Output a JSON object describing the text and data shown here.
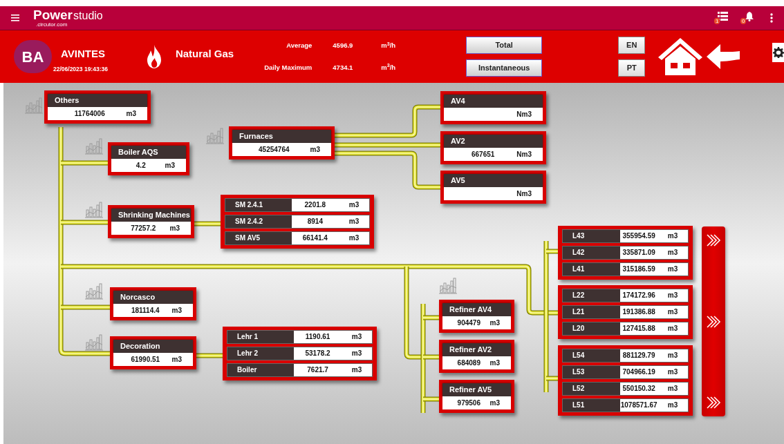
{
  "top_bar": {
    "logo": {
      "brand": "Power",
      "product": "studio",
      "domain": ".circutor.com"
    },
    "notifications": [
      {
        "kind": "list",
        "count": "1"
      },
      {
        "kind": "bell",
        "count": "0"
      }
    ]
  },
  "header": {
    "avatar": "BA",
    "site": "AVINTES",
    "datetime": "22/06/2023 19:43:36",
    "energy": "Natural Gas",
    "stats": [
      {
        "label": "Average",
        "value": "4596.9",
        "unit": "m$^{3}$/h"
      },
      {
        "label": "Daily Maximum",
        "value": "4734.1",
        "unit": "m$^{3}$/h"
      }
    ],
    "mode_buttons": [
      "Total",
      "Instantaneous"
    ],
    "language_buttons": [
      "EN",
      "PT"
    ]
  },
  "nodes": [
    {
      "title": "Others",
      "value": "11764006",
      "unit": "m3",
      "chart_icon": true
    },
    {
      "title": "Boiler AQS",
      "value": "4.2",
      "unit": "m3",
      "chart_icon": true
    },
    {
      "title": "Furnaces",
      "value": "45254764",
      "unit": "m3",
      "chart_icon": true
    },
    {
      "title": "Shrinking Machines",
      "value": "77257.2",
      "unit": "m3",
      "chart_icon": true
    },
    {
      "title": "AV4",
      "unit": "Nm3",
      "chart_icon": false
    },
    {
      "title": "AV2",
      "value": "667651",
      "unit": "Nm3",
      "chart_icon": false
    },
    {
      "title": "AV5",
      "unit": "Nm3",
      "chart_icon": false
    },
    {
      "title": "Norcasco",
      "value": "181114.4",
      "unit": "m3",
      "chart_icon": true
    },
    {
      "title": "Decoration",
      "value": "61990.51",
      "unit": "m3",
      "chart_icon": true
    },
    {
      "title": "Refiner AV4",
      "value": "904479",
      "unit": "m3",
      "chart_icon": true
    },
    {
      "title": "Refiner AV2",
      "value": "684089",
      "unit": "m3",
      "chart_icon": false
    },
    {
      "title": "Refiner AV5",
      "value": "979506",
      "unit": "m3",
      "chart_icon": false
    }
  ],
  "groups": [
    {
      "rows": [
        {
          "label": "SM 2.4.1",
          "value": "2201.8",
          "unit": "m3"
        },
        {
          "label": "SM 2.4.2",
          "value": "8914",
          "unit": "m3"
        },
        {
          "label": "SM AV5",
          "value": "66141.4",
          "unit": "m3"
        }
      ]
    },
    {
      "rows": [
        {
          "label": "Lehr 1",
          "value": "1190.61",
          "unit": "m3"
        },
        {
          "label": "Lehr 2",
          "value": "53178.2",
          "unit": "m3"
        },
        {
          "label": "Boiler",
          "value": "7621.7",
          "unit": "m3"
        }
      ]
    },
    {
      "rows": [
        {
          "label": "L43",
          "value": "355954.59",
          "unit": "m3"
        },
        {
          "label": "L42",
          "value": "335871.09",
          "unit": "m3"
        },
        {
          "label": "L41",
          "value": "315186.59",
          "unit": "m3"
        }
      ]
    },
    {
      "rows": [
        {
          "label": "L22",
          "value": "174172.96",
          "unit": "m3"
        },
        {
          "label": "L21",
          "value": "191386.88",
          "unit": "m3"
        },
        {
          "label": "L20",
          "value": "127415.88",
          "unit": "m3"
        }
      ]
    },
    {
      "rows": [
        {
          "label": "L54",
          "value": "881129.79",
          "unit": "m3"
        },
        {
          "label": "L53",
          "value": "704966.19",
          "unit": "m3"
        },
        {
          "label": "L52",
          "value": "550150.32",
          "unit": "m3"
        },
        {
          "label": "L51",
          "value": "1078571.67",
          "unit": "m3"
        }
      ]
    }
  ]
}
